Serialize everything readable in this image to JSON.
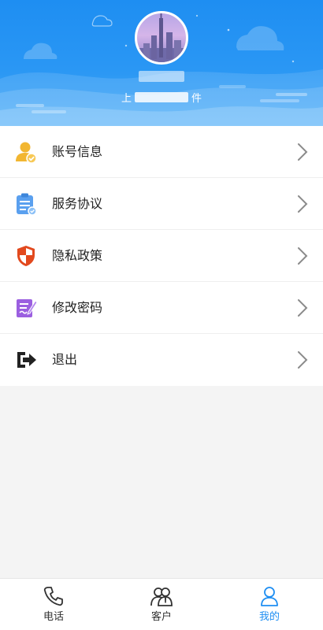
{
  "profile": {
    "name": "",
    "subtitle_start": "上",
    "subtitle_end": "件"
  },
  "menu": {
    "items": [
      {
        "label": "账号信息",
        "icon": "user-check-icon"
      },
      {
        "label": "服务协议",
        "icon": "clipboard-icon"
      },
      {
        "label": "隐私政策",
        "icon": "shield-icon"
      },
      {
        "label": "修改密码",
        "icon": "edit-password-icon"
      },
      {
        "label": "退出",
        "icon": "logout-icon"
      }
    ]
  },
  "tabbar": {
    "items": [
      {
        "label": "电话",
        "icon": "phone-icon"
      },
      {
        "label": "客户",
        "icon": "contacts-icon"
      },
      {
        "label": "我的",
        "icon": "person-icon"
      }
    ],
    "active_index": 2
  },
  "colors": {
    "accent": "#1e8ef2",
    "header_top": "#1e8ef2",
    "header_bottom": "#44a9f7",
    "text": "#222222",
    "chevron": "#8a8a8a"
  }
}
